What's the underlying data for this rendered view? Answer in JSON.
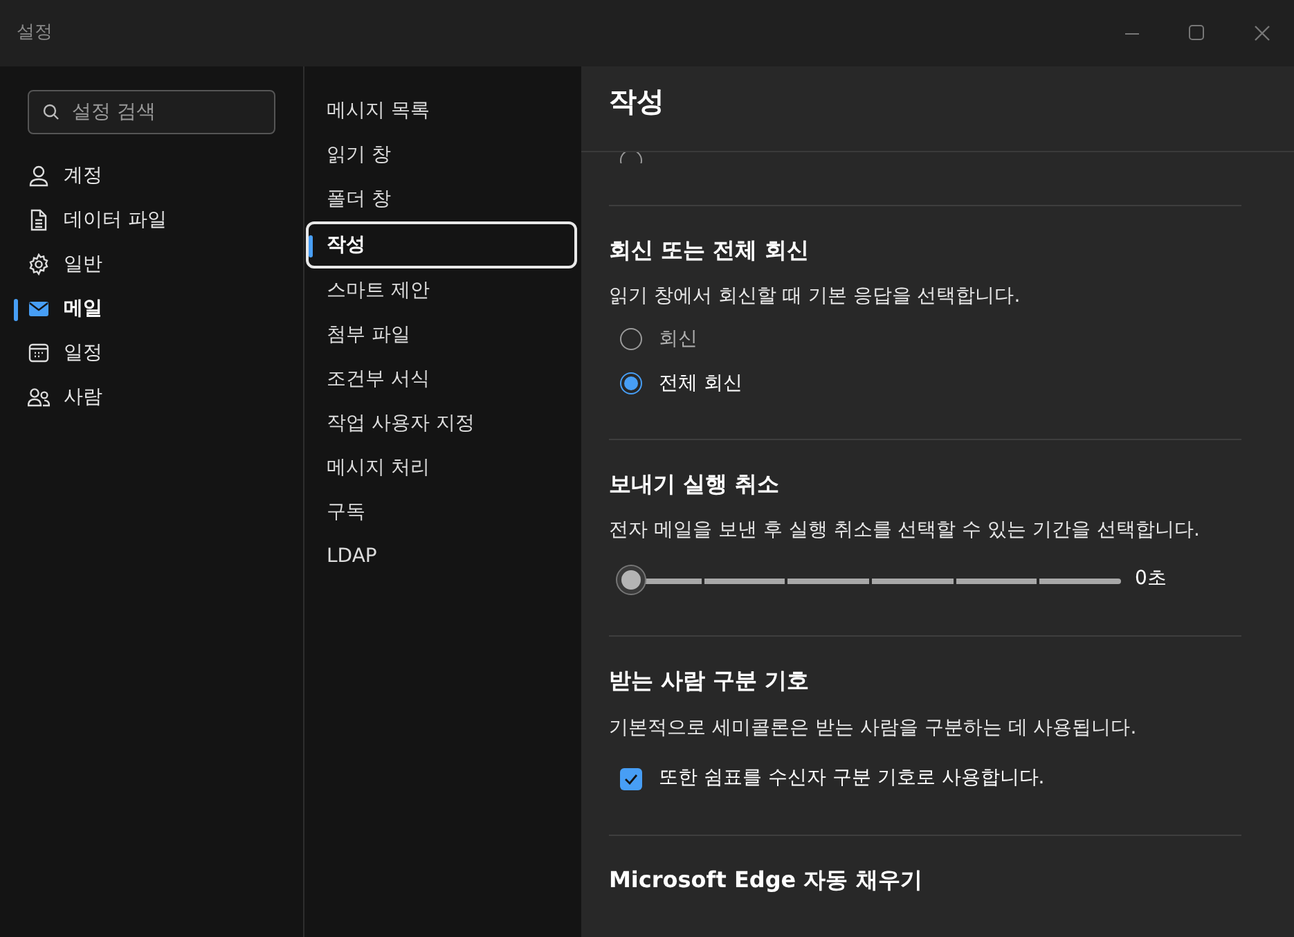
{
  "window": {
    "title": "설정"
  },
  "search": {
    "placeholder": "설정 검색"
  },
  "sidebar": {
    "items": [
      {
        "label": "계정",
        "selected": false
      },
      {
        "label": "데이터 파일",
        "selected": false
      },
      {
        "label": "일반",
        "selected": false
      },
      {
        "label": "메일",
        "selected": true
      },
      {
        "label": "일정",
        "selected": false
      },
      {
        "label": "사람",
        "selected": false
      }
    ]
  },
  "subnav": {
    "items": [
      {
        "label": "메시지 목록",
        "selected": false
      },
      {
        "label": "읽기 창",
        "selected": false
      },
      {
        "label": "폴더 창",
        "selected": false
      },
      {
        "label": "작성",
        "selected": true
      },
      {
        "label": "스마트 제안",
        "selected": false
      },
      {
        "label": "첨부 파일",
        "selected": false
      },
      {
        "label": "조건부 서식",
        "selected": false
      },
      {
        "label": "작업 사용자 지정",
        "selected": false
      },
      {
        "label": "메시지 처리",
        "selected": false
      },
      {
        "label": "구독",
        "selected": false
      },
      {
        "label": "LDAP",
        "selected": false
      }
    ]
  },
  "content": {
    "title": "작성",
    "partial_option": {
      "selected": false
    },
    "sections": [
      {
        "kind": "radio",
        "heading": "회신 또는 전체 회신",
        "description": "읽기 창에서 회신할 때 기본 응답을 선택합니다.",
        "options": [
          {
            "label": "회신",
            "selected": false
          },
          {
            "label": "전체 회신",
            "selected": true
          }
        ]
      },
      {
        "kind": "slider",
        "heading": "보내기 실행 취소",
        "description": "전자 메일을 보낸 후 실행 취소를 선택할 수 있는 기간을 선택합니다.",
        "level": 0,
        "reading": "0초"
      },
      {
        "kind": "checkbox",
        "heading": "받는 사람 구분 기호",
        "description": "기본적으로 세미콜론은 받는 사람을 구분하는 데 사용됩니다.",
        "label": "또한 쉼표를 수신자 구분 기호로 사용합니다.",
        "checked": true
      },
      {
        "kind": "heading",
        "heading": "Microsoft Edge 자동 채우기"
      }
    ]
  }
}
